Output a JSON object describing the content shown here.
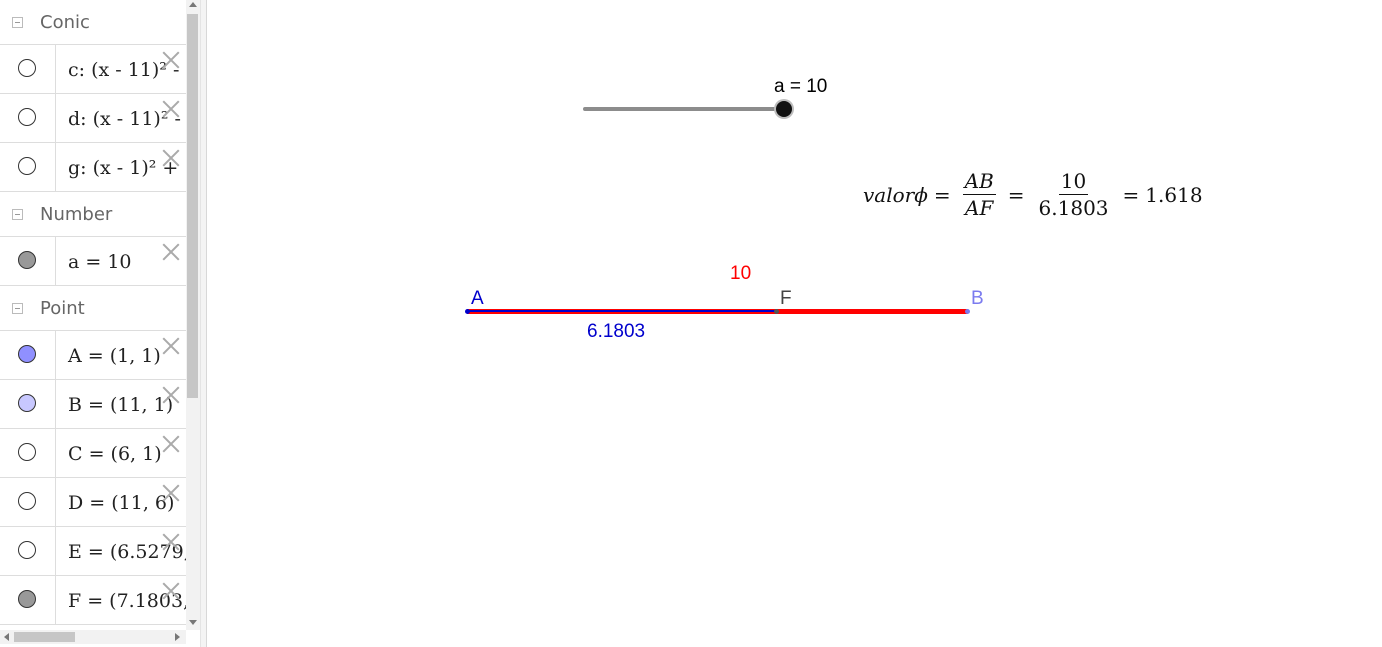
{
  "algebra": {
    "groups": {
      "conic": {
        "title": "Conic",
        "items": [
          {
            "def": "c: (x - 11)² -"
          },
          {
            "def": "d: (x - 11)² -"
          },
          {
            "def": "g: (x - 1)² +"
          }
        ]
      },
      "number": {
        "title": "Number",
        "items": [
          {
            "def": "a = 10"
          }
        ]
      },
      "point": {
        "title": "Point",
        "items": [
          {
            "def": "A = (1, 1)"
          },
          {
            "def": "B = (11, 1)"
          },
          {
            "def": "C = (6, 1)"
          },
          {
            "def": "D = (11, 6)"
          },
          {
            "def": "E = (6.5279,"
          },
          {
            "def": "F = (7.1803,"
          }
        ]
      }
    },
    "marble_colors": {
      "conic": "#ffffff",
      "number": "#999999",
      "A": "#9090ff",
      "B": "#c8c8ff",
      "C": "#ffffff",
      "D": "#ffffff",
      "E": "#ffffff",
      "F": "#999999"
    }
  },
  "graphics": {
    "slider": {
      "label": "a = 10",
      "value": 10,
      "min": 0,
      "max": 10
    },
    "formula": {
      "lhs": "valorϕ",
      "eq": "=",
      "frac1_num": "AB",
      "frac1_den": "AF",
      "frac2_num": "10",
      "frac2_den": "6.1803",
      "result": "1.618"
    },
    "points": {
      "A": "A",
      "F": "F",
      "B": "B"
    },
    "length_labels": {
      "AB": "10",
      "AF": "6.1803"
    },
    "colors": {
      "segment_AB": "#ff0000",
      "segment_AF": "#0000cc",
      "label_A": "#0000cc",
      "label_F": "#444444",
      "label_B": "#7b7bef",
      "length_AB": "#ff0000",
      "length_AF": "#0000cc"
    }
  }
}
